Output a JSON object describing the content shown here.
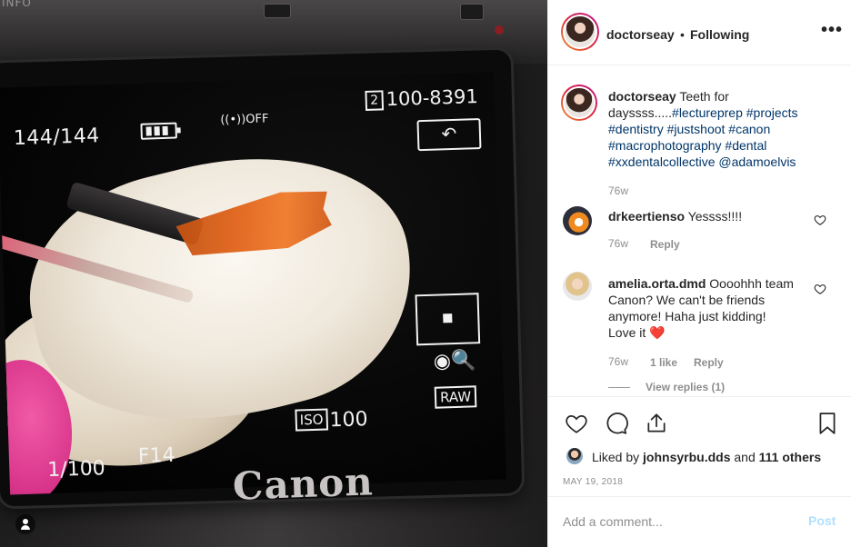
{
  "photo": {
    "camera_top_label": "INFO",
    "screen": {
      "shots_remaining": "144/144",
      "wifi_status": "((•))OFF",
      "folder_index": "2",
      "file_number": "100-8391",
      "return_symbol": "↶",
      "zoom_symbol": "◉🔍",
      "raw_label": "RAW",
      "iso_label": "ISO",
      "iso_value": "100",
      "shutter_speed": "1/100",
      "aperture": "F14"
    },
    "brand_logo": "Canon",
    "icons": [
      "user-tag-icon"
    ]
  },
  "header": {
    "username": "doctorseay",
    "separator": "•",
    "follow_status": "Following",
    "more_label": "•••"
  },
  "caption": {
    "username": "doctorseay",
    "text_plain": "Teeth for dayssss.....",
    "hashtags_line1": "#lectureprep #projects",
    "hashtags_line2": "#dentistry #justshoot #canon",
    "hashtags_line3": "#macrophotography #dental",
    "hashtags_line4": "#xxdentalcollective @adamoelvis",
    "time": "76w"
  },
  "comments": [
    {
      "username": "drkeertienso",
      "text": "Yessss!!!!",
      "time": "76w",
      "reply_label": "Reply"
    },
    {
      "username": "amelia.orta.dmd",
      "text_line1": "Oooohhh team",
      "text_line2": "Canon? We can't be friends",
      "text_line3": "anymore! Haha just kidding!",
      "text_line4": "Love it ❤️",
      "time": "76w",
      "likes": "1 like",
      "reply_label": "Reply",
      "view_replies": "View replies (1)"
    }
  ],
  "actions": {
    "liked_by_prefix": "Liked by",
    "liked_by_user": "johnsyrbu.dds",
    "liked_by_and": "and",
    "liked_by_others": "111 others",
    "date": "MAY 19, 2018"
  },
  "add_comment": {
    "placeholder": "Add a comment...",
    "post_label": "Post"
  },
  "colors": {
    "link": "#003569",
    "meta": "#8e8e8e",
    "post_disabled": "#b2dffc",
    "heart_red": "#ed4956"
  }
}
